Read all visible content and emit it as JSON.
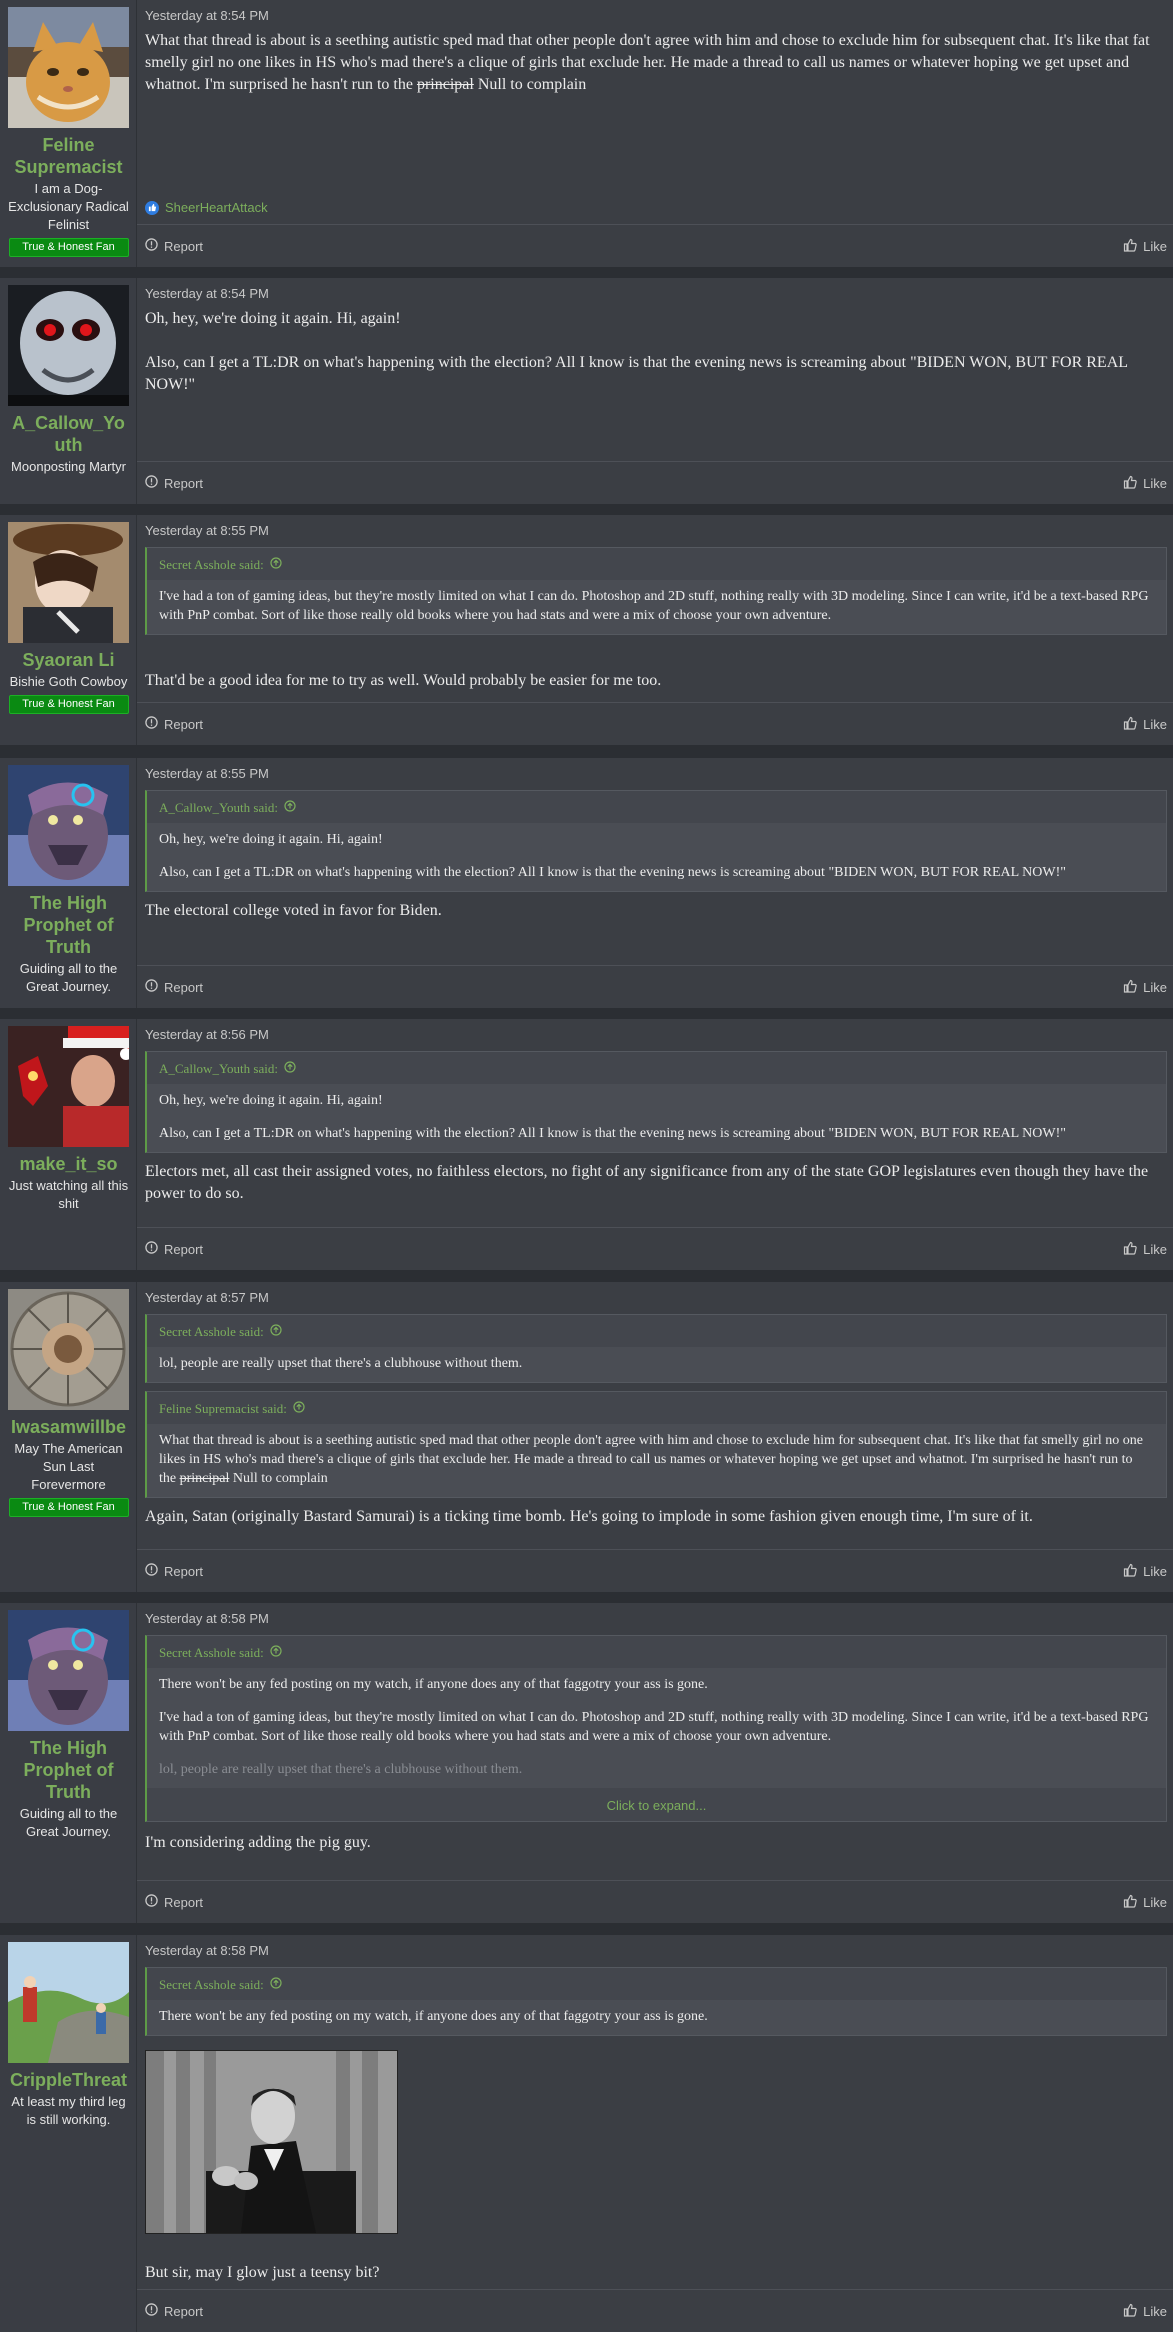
{
  "ui": {
    "report_label": "Report",
    "like_label": "Like",
    "click_to_expand": "Click to expand..."
  },
  "posts": [
    {
      "username": "Feline Supremacist",
      "title": "I am a Dog-Exclusionary Radical Felinist",
      "badge": "True & Honest Fan",
      "time": "Yesterday at 8:54 PM",
      "body_a": "What that thread is about is a seething autistic sped mad that other people don't agree with him and chose to exclude him for subsequent chat. It's like that fat smelly girl no one likes in HS who's mad there's a clique of girls that exclude her. He made a thread to call us names or whatever hoping we get upset and whatnot. I'm surprised he hasn't run to the ",
      "body_strike": "principal",
      "body_b": " Null to complain",
      "reaction_user": "SheerHeartAttack"
    },
    {
      "username": "A_Callow_Youth",
      "title": "Moonposting Martyr",
      "time": "Yesterday at 8:54 PM",
      "body_p1": "Oh, hey, we're doing it again. Hi, again!",
      "body_p2": "Also, can I get a TL:DR on what's happening with the election? All I know is that the evening news is screaming about \"BIDEN WON, BUT FOR REAL NOW!\""
    },
    {
      "username": "Syaoran Li",
      "title": "Bishie Goth Cowboy",
      "badge": "True & Honest Fan",
      "time": "Yesterday at 8:55 PM",
      "quote_author": "Secret Asshole said:",
      "quote_text": "I've had a ton of gaming ideas, but they're mostly limited on what I can do. Photoshop and 2D stuff, nothing really with 3D modeling. Since I can write, it'd be a text-based RPG with PnP combat. Sort of like those really old books where you had stats and were a mix of choose your own adventure.",
      "body": "That'd be a good idea for me to try as well. Would probably be easier for me too."
    },
    {
      "username": "The High Prophet of Truth",
      "title": "Guiding all to the Great Journey.",
      "time": "Yesterday at 8:55 PM",
      "quote_author": "A_Callow_Youth said:",
      "quote_p1": "Oh, hey, we're doing it again. Hi, again!",
      "quote_p2": "Also, can I get a TL:DR on what's happening with the election? All I know is that the evening news is screaming about \"BIDEN WON, BUT FOR REAL NOW!\"",
      "body": "The electoral college voted in favor for Biden."
    },
    {
      "username": "make_it_so",
      "title": "Just watching all this shit",
      "time": "Yesterday at 8:56 PM",
      "quote_author": "A_Callow_Youth said:",
      "quote_p1": "Oh, hey, we're doing it again. Hi, again!",
      "quote_p2": "Also, can I get a TL:DR on what's happening with the election? All I know is that the evening news is screaming about \"BIDEN WON, BUT FOR REAL NOW!\"",
      "body": "Electors met, all cast their assigned votes, no faithless electors, no fight of any significance from any of the state GOP legislatures even though they have the power to do so."
    },
    {
      "username": "Iwasamwillbe",
      "title": "May The American Sun Last Forevermore",
      "badge": "True & Honest Fan",
      "time": "Yesterday at 8:57 PM",
      "quote1_author": "Secret Asshole said:",
      "quote1_text": "lol, people are really upset that there's a clubhouse without them.",
      "quote2_author": "Feline Supremacist said:",
      "quote2_a": "What that thread is about is a seething autistic sped mad that other people don't agree with him and chose to exclude him for subsequent chat. It's like that fat smelly girl no one likes in HS who's mad there's a clique of girls that exclude her. He made a thread to call us names or whatever hoping we get upset and whatnot. I'm surprised he hasn't run to the ",
      "quote2_strike": "principal",
      "quote2_b": " Null to complain",
      "body": "Again, Satan (originally Bastard Samurai) is a ticking time bomb. He's going to implode in some fashion given enough time, I'm sure of it."
    },
    {
      "username": "The High Prophet of Truth",
      "title": "Guiding all to the Great Journey.",
      "time": "Yesterday at 8:58 PM",
      "quote_author": "Secret Asshole said:",
      "quote_p1": "There won't be any fed posting on my watch, if anyone does any of that faggotry your ass is gone.",
      "quote_p2": "I've had a ton of gaming ideas, but they're mostly limited on what I can do. Photoshop and 2D stuff, nothing really with 3D modeling. Since I can write, it'd be a text-based RPG with PnP combat. Sort of like those really old books where you had stats and were a mix of choose your own adventure.",
      "quote_p3": "lol, people are really upset that there's a clubhouse without them.",
      "body": "I'm considering adding the pig guy."
    },
    {
      "username": "CrippleThreat",
      "title": "At least my third leg is still working.",
      "time": "Yesterday at 8:58 PM",
      "quote_author": "Secret Asshole said:",
      "quote_text": "There won't be any fed posting on my watch, if anyone does any of that faggotry your ass is gone.",
      "body": "But sir, may I glow just a teensy bit?"
    }
  ],
  "colors": {
    "username": "#7cae5c",
    "badge": "#0a8a12",
    "quote_bar": "#5e9b47",
    "link": "#7cae5c",
    "reaction": "#2f7de1"
  },
  "icons": [
    "report-icon",
    "like-icon",
    "quote-arrow-icon",
    "reaction-like-icon"
  ]
}
